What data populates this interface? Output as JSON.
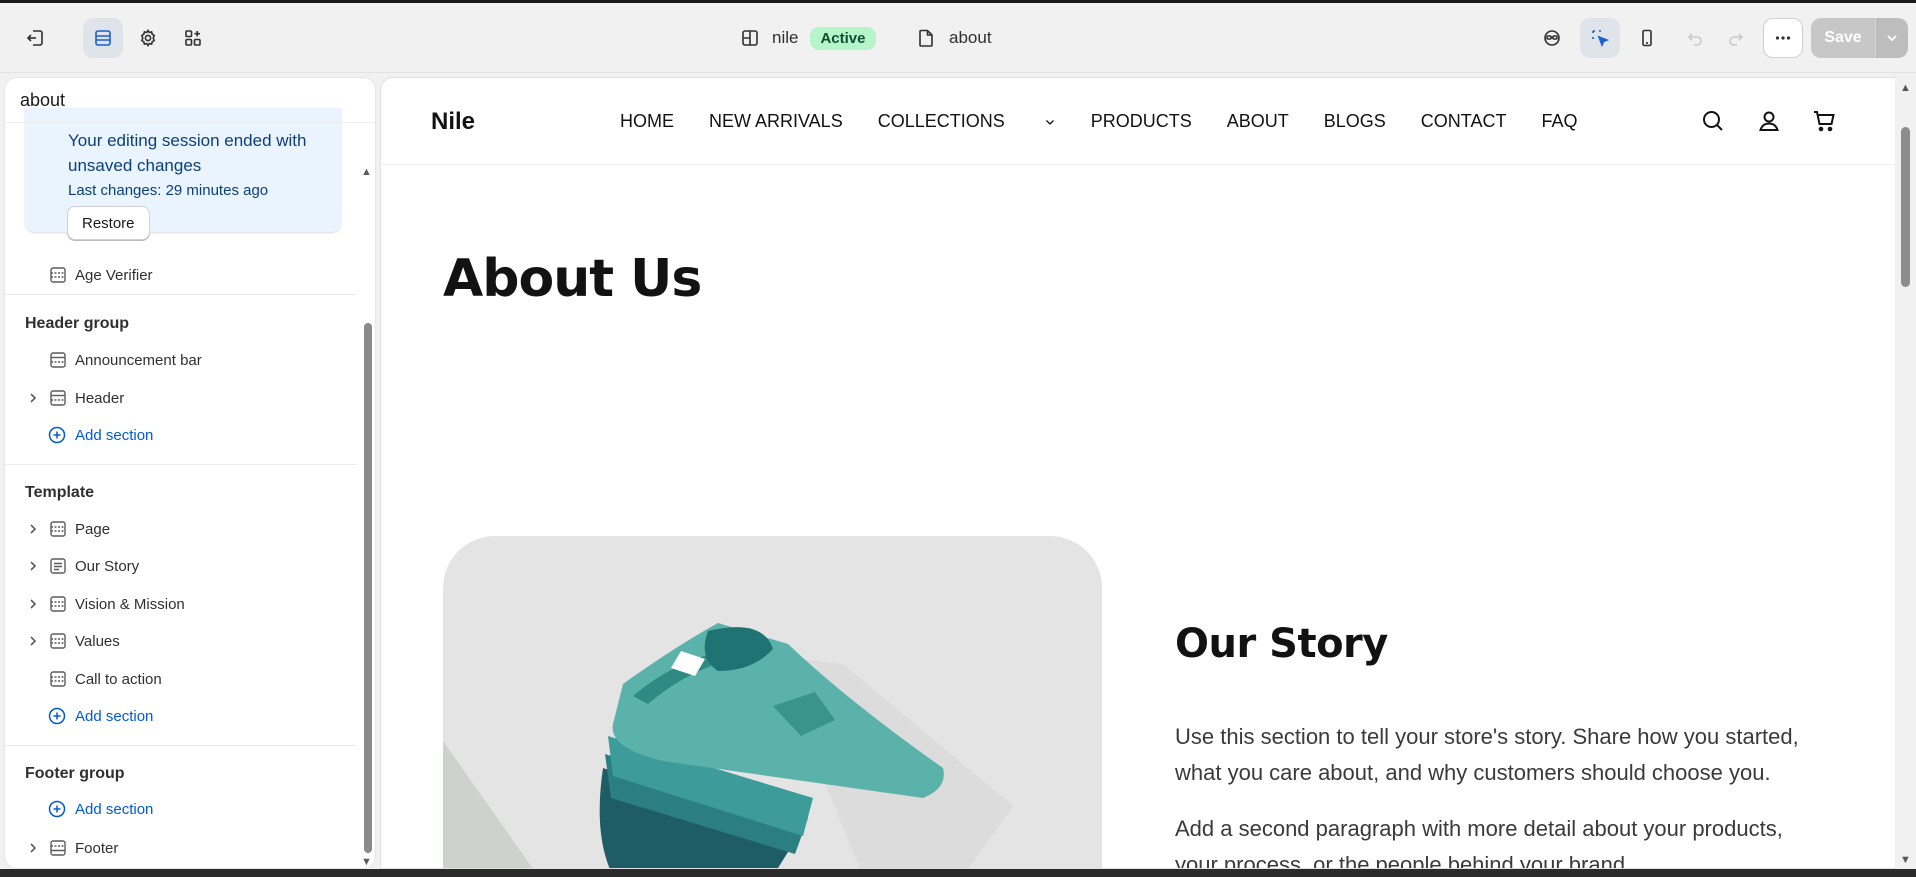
{
  "topbar": {
    "theme_name": "nile",
    "theme_status": "Active",
    "page_name": "about",
    "save_label": "Save"
  },
  "panel": {
    "title": "about",
    "notice": {
      "message": "Your editing session ended with unsaved changes",
      "last_changes": "Last changes: 29 minutes ago",
      "restore_label": "Restore"
    },
    "age_verifier": "Age Verifier",
    "header_group": {
      "title": "Header group",
      "items": [
        "Announcement bar",
        "Header"
      ],
      "add_label": "Add section"
    },
    "template": {
      "title": "Template",
      "items": [
        "Page",
        "Our Story",
        "Vision & Mission",
        "Values",
        "Call to action"
      ],
      "add_label": "Add section"
    },
    "footer_group": {
      "title": "Footer group",
      "add_label": "Add section",
      "items": [
        "Footer"
      ]
    }
  },
  "site": {
    "logo": "Nile",
    "nav": [
      "HOME",
      "NEW ARRIVALS",
      "COLLECTIONS",
      "PRODUCTS",
      "ABOUT",
      "BLOGS",
      "CONTACT",
      "FAQ"
    ],
    "page_heading": "About Us",
    "story_heading": "Our Story",
    "paragraphs": [
      "Use this section to tell your store's story. Share how you started, what you care about, and why customers should choose you.",
      "Add a second paragraph with more detail about your products, your process, or the people behind your brand."
    ]
  },
  "colors": {
    "accent": "#005bd3",
    "badge_bg": "#b5f5c9",
    "notice_bg": "#eaf4ff",
    "shirt": "#5ab2ab"
  }
}
